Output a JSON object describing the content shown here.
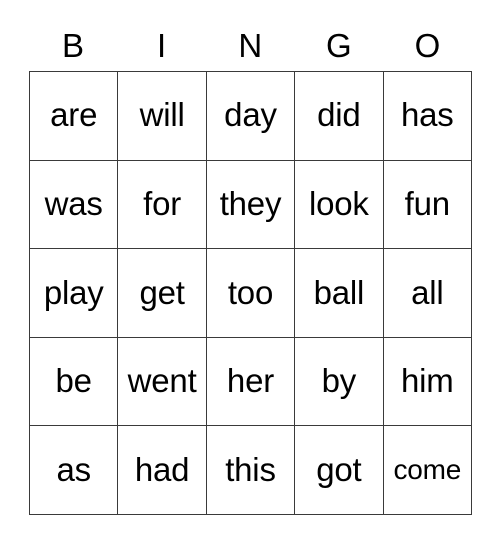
{
  "card": {
    "header_letters": [
      "B",
      "I",
      "N",
      "G",
      "O"
    ],
    "columns": [
      "B",
      "I",
      "N",
      "G",
      "O"
    ],
    "rows": [
      {
        "cells": [
          {
            "text": "are",
            "fit": "normal"
          },
          {
            "text": "will",
            "fit": "normal"
          },
          {
            "text": "day",
            "fit": "normal"
          },
          {
            "text": "did",
            "fit": "normal"
          },
          {
            "text": "has",
            "fit": "normal"
          }
        ]
      },
      {
        "cells": [
          {
            "text": "was",
            "fit": "normal"
          },
          {
            "text": "for",
            "fit": "normal"
          },
          {
            "text": "they",
            "fit": "normal"
          },
          {
            "text": "look",
            "fit": "normal"
          },
          {
            "text": "fun",
            "fit": "normal"
          }
        ]
      },
      {
        "cells": [
          {
            "text": "play",
            "fit": "normal"
          },
          {
            "text": "get",
            "fit": "normal"
          },
          {
            "text": "too",
            "fit": "normal"
          },
          {
            "text": "ball",
            "fit": "normal"
          },
          {
            "text": "all",
            "fit": "normal"
          }
        ]
      },
      {
        "cells": [
          {
            "text": "be",
            "fit": "normal"
          },
          {
            "text": "went",
            "fit": "normal"
          },
          {
            "text": "her",
            "fit": "normal"
          },
          {
            "text": "by",
            "fit": "normal"
          },
          {
            "text": "him",
            "fit": "normal"
          }
        ]
      },
      {
        "cells": [
          {
            "text": "as",
            "fit": "normal"
          },
          {
            "text": "had",
            "fit": "normal"
          },
          {
            "text": "this",
            "fit": "normal"
          },
          {
            "text": "got",
            "fit": "normal"
          },
          {
            "text": "come",
            "fit": "small"
          }
        ]
      }
    ],
    "colors": {
      "background": "#ffffff",
      "border": "#3a3a3a",
      "text": "#000000"
    }
  }
}
